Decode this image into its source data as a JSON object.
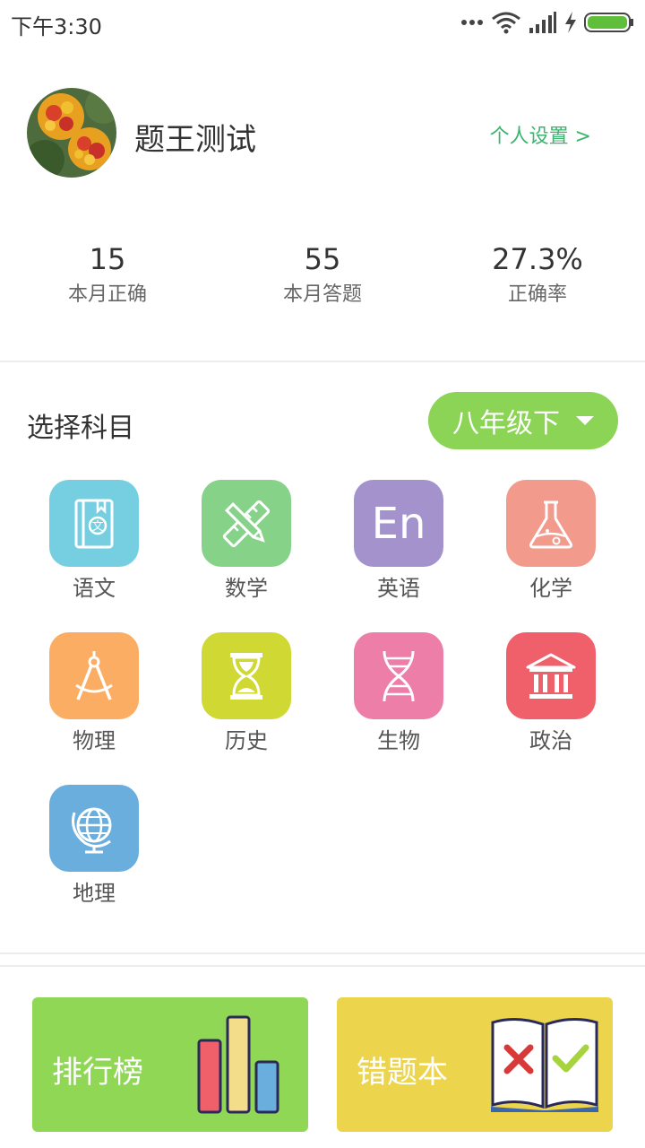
{
  "status_bar": {
    "time": "下午3:30"
  },
  "profile": {
    "username": "题王测试",
    "settings_link": "个人设置 >"
  },
  "stats": [
    {
      "value": "15",
      "label": "本月正确"
    },
    {
      "value": "55",
      "label": "本月答题"
    },
    {
      "value": "27.3%",
      "label": "正确率"
    }
  ],
  "subject_section": {
    "title": "选择科目",
    "grade": "八年级下"
  },
  "subjects": [
    {
      "label": "语文",
      "icon": "chinese-book-icon",
      "color": "#76cfe0"
    },
    {
      "label": "数学",
      "icon": "ruler-pencil-icon",
      "color": "#86d289"
    },
    {
      "label": "英语",
      "icon": "en-text-icon",
      "color": "#a392cc",
      "icon_text": "En"
    },
    {
      "label": "化学",
      "icon": "flask-icon",
      "color": "#f29a8c"
    },
    {
      "label": "物理",
      "icon": "compass-icon",
      "color": "#fbad63"
    },
    {
      "label": "历史",
      "icon": "hourglass-icon",
      "color": "#d0d834"
    },
    {
      "label": "生物",
      "icon": "dna-icon",
      "color": "#ec7ea8"
    },
    {
      "label": "政治",
      "icon": "government-building-icon",
      "color": "#f0606b"
    },
    {
      "label": "地理",
      "icon": "globe-icon",
      "color": "#6aaede"
    }
  ],
  "cards": [
    {
      "label": "排行榜",
      "icon": "bar-chart-icon",
      "color": "#8fd755"
    },
    {
      "label": "错题本",
      "icon": "open-book-icon",
      "color": "#ecd44c"
    }
  ]
}
